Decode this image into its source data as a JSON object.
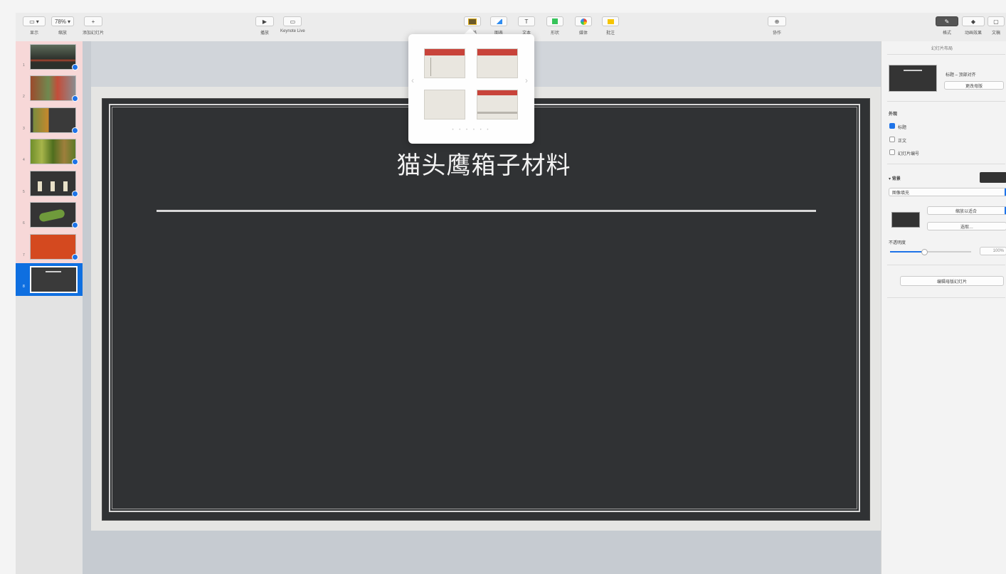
{
  "toolbar": {
    "left": [
      {
        "id": "view",
        "icon": "sidebar-icon",
        "caret": "▾",
        "label": "显示"
      },
      {
        "id": "zoom",
        "value": "78%",
        "caret": "▾",
        "label": "缩放"
      },
      {
        "id": "add-slide",
        "glyph": "+",
        "label": "添加幻灯片"
      }
    ],
    "middle": [
      {
        "id": "play",
        "glyph": "▶",
        "label": "播放"
      },
      {
        "id": "keynote-live",
        "glyph": "▭",
        "label": "Keynote Live"
      }
    ],
    "insert": [
      {
        "id": "table",
        "label": "表格",
        "color": "#e2b11e"
      },
      {
        "id": "chart",
        "label": "图表",
        "color": "#2f8cf0"
      },
      {
        "id": "text",
        "glyph": "T",
        "label": "文本",
        "color": "#555555"
      },
      {
        "id": "shape",
        "label": "形状",
        "color": "#36c45a"
      },
      {
        "id": "media",
        "label": "媒体",
        "color": "#e94a3d"
      },
      {
        "id": "comment",
        "label": "批注",
        "color": "#f5c400"
      }
    ],
    "collaborate": {
      "glyph": "⊕",
      "label": "协作"
    },
    "right": [
      {
        "id": "format",
        "glyph": "✎",
        "label": "格式",
        "active": true
      },
      {
        "id": "animate",
        "glyph": "◆",
        "label": "动画效果"
      },
      {
        "id": "document",
        "glyph": "▢",
        "label": "文稿"
      }
    ]
  },
  "navigator": {
    "slides": [
      {
        "num": "1",
        "style": "photo-dark",
        "check": true
      },
      {
        "num": "2",
        "style": "photo-red",
        "check": true
      },
      {
        "num": "3",
        "style": "dark-split",
        "check": true
      },
      {
        "num": "4",
        "style": "photo-green",
        "check": true
      },
      {
        "num": "5",
        "style": "dark-bottles",
        "check": true
      },
      {
        "num": "6",
        "style": "dark-plant",
        "check": true
      },
      {
        "num": "7",
        "style": "orange",
        "check": true
      },
      {
        "num": "8",
        "style": "selected",
        "check": false
      }
    ]
  },
  "slide": {
    "title": "猫头鹰箱子材料"
  },
  "popover": {
    "prev": "‹",
    "next": "›",
    "dots": "• • • • • •",
    "layouts": [
      "title-sidebar",
      "title-top",
      "blank",
      "title-bottom-bar"
    ]
  },
  "inspector": {
    "header": "幻灯片布局",
    "master_name": "标题 – 顶部对齐",
    "change_master": "更改母版",
    "appearance": "外观",
    "show_title": "标题",
    "show_body": "正文",
    "show_slide_number": "幻灯片编号",
    "background": "背景",
    "fill_type": "图像填充",
    "scale": "缩放以适合",
    "choose": "选取…",
    "opacity": "不透明度",
    "opacity_value": "100%",
    "opacity_fraction": 0.42,
    "edit_master": "编辑母版幻灯片",
    "colors": {
      "accent": "#1e73e8",
      "swatch": "#333333"
    }
  }
}
